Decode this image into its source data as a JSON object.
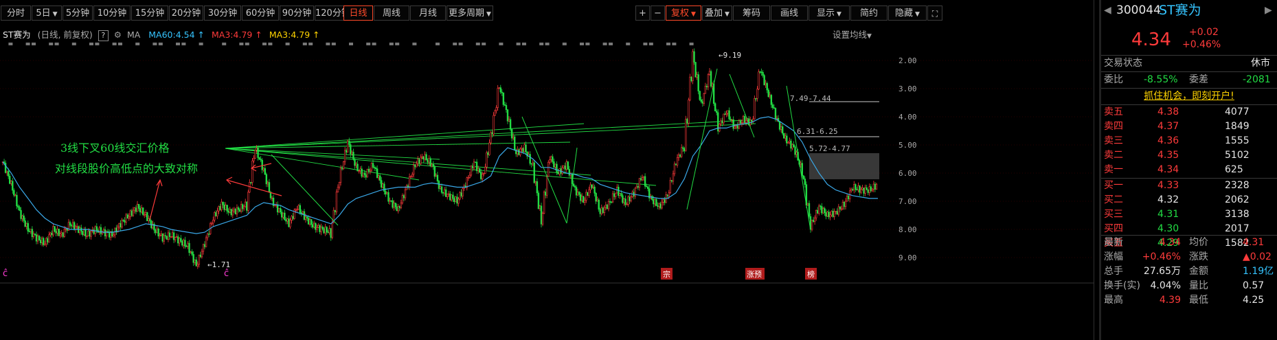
{
  "toolbar": {
    "periods": [
      "分时",
      "5日",
      "5分钟",
      "10分钟",
      "15分钟",
      "20分钟",
      "30分钟",
      "60分钟",
      "90分钟",
      "120分钟",
      "日线",
      "周线",
      "月线",
      "更多周期"
    ],
    "active_period": "日线",
    "plus": "+",
    "minus": "−",
    "fuquan": "复权",
    "diejia": "叠加",
    "chouma": "筹码",
    "huaxian": "画线",
    "xianshi": "显示",
    "jianyue": "简约",
    "yincang": "隐藏"
  },
  "info": {
    "name": "ST赛为",
    "mode": "(日线, 前复权)",
    "help": "?",
    "ma_label": "MA",
    "ma60": "MA60:4.54",
    "ma3a": "MA3:4.79",
    "ma3b": "MA3:4.79",
    "setting": "设置均线",
    "up_arrow": "↑"
  },
  "chart": {
    "y_ticks": [
      "9.00",
      "8.00",
      "7.00",
      "6.00",
      "5.00",
      "4.00",
      "3.00",
      "2.00"
    ],
    "label_high": "←9.19",
    "label_low": "←1.71",
    "band1": "7.49-7.44",
    "band2": "6.31-6.25",
    "band3": "5.72-4.77",
    "annotation1": "3线下叉60线交汇价格",
    "annotation2": "对线段股价高低点的大致对称",
    "badge1": "宗",
    "badge2": "涨预",
    "badge3": "榜",
    "colors": {
      "up": "#ff3b3b",
      "down": "#22dd44",
      "ma60": "#3aa8e8",
      "annotation": "#22dd44",
      "arrow": "#ff3b3b"
    }
  },
  "chart_data": {
    "type": "line",
    "series": [
      {
        "name": "MA60",
        "value_last": 4.54
      },
      {
        "name": "MA3",
        "value_last": 4.79
      }
    ],
    "ylim": [
      1.7,
      9.3
    ],
    "y_ticks": [
      2.0,
      3.0,
      4.0,
      5.0,
      6.0,
      7.0,
      8.0,
      9.0
    ],
    "price_path": [
      5.4,
      4.6,
      3.6,
      3.0,
      2.7,
      2.5,
      3.0,
      2.8,
      3.2,
      3.0,
      2.8,
      3.0,
      2.9,
      2.8,
      3.2,
      3.5,
      3.8,
      3.5,
      3.0,
      2.7,
      2.8,
      2.6,
      2.4,
      1.71,
      2.5,
      3.4,
      3.9,
      3.6,
      3.7,
      3.9,
      5.9,
      5.1,
      4.0,
      3.6,
      3.2,
      3.8,
      3.4,
      3.1,
      3.0,
      2.9,
      4.8,
      6.1,
      5.2,
      4.9,
      5.3,
      4.6,
      4.0,
      3.7,
      4.5,
      5.3,
      5.6,
      5.3,
      4.4,
      4.2,
      4.0,
      4.6,
      5.4,
      4.8,
      6.3,
      8.1,
      7.0,
      5.7,
      5.9,
      5.2,
      3.3,
      5.6,
      5.0,
      5.3,
      4.4,
      4.0,
      4.6,
      3.6,
      3.9,
      4.4,
      3.9,
      4.3,
      4.9,
      4.1,
      3.8,
      4.2,
      5.4,
      6.0,
      9.19,
      7.4,
      8.6,
      6.6,
      7.2,
      6.6,
      6.9,
      6.8,
      8.7,
      7.8,
      6.9,
      6.2,
      5.9,
      5.1,
      3.1,
      3.8,
      3.5,
      3.6,
      3.9,
      4.5,
      4.4,
      4.4,
      4.6
    ],
    "ma60_path": [
      5.4,
      5.0,
      4.5,
      4.1,
      3.7,
      3.4,
      3.2,
      3.1,
      3.0,
      3.0,
      3.0,
      2.95,
      2.9,
      2.9,
      2.95,
      3.0,
      3.1,
      3.2,
      3.15,
      3.1,
      3.0,
      2.95,
      2.9,
      2.85,
      2.9,
      3.1,
      3.2,
      3.3,
      3.4,
      3.5,
      3.8,
      3.95,
      3.9,
      3.85,
      3.7,
      3.6,
      3.5,
      3.4,
      3.3,
      3.2,
      3.5,
      3.9,
      4.1,
      4.2,
      4.3,
      4.4,
      4.45,
      4.5,
      4.5,
      4.5,
      4.6,
      4.65,
      4.6,
      4.55,
      4.5,
      4.5,
      4.6,
      4.7,
      4.9,
      5.6,
      5.9,
      5.8,
      5.7,
      5.5,
      5.2,
      5.2,
      5.1,
      5.0,
      4.95,
      4.85,
      4.8,
      4.6,
      4.5,
      4.4,
      4.3,
      4.25,
      4.2,
      4.15,
      4.1,
      4.1,
      4.3,
      4.8,
      5.6,
      6.0,
      6.5,
      6.6,
      6.6,
      6.7,
      6.75,
      6.8,
      6.95,
      7.0,
      6.9,
      6.7,
      6.5,
      6.1,
      5.5,
      5.0,
      4.6,
      4.4,
      4.3,
      4.2,
      4.15,
      4.1,
      4.1
    ]
  },
  "side": {
    "code": "300044",
    "name": "ST赛为",
    "price": "4.34",
    "change": "+0.02",
    "change_pct": "+0.46%",
    "status_label": "交易状态",
    "status_value": "休市",
    "weibi_label": "委比",
    "weibi_value": "-8.55%",
    "weicha_label": "委差",
    "weicha_value": "-2081",
    "promo": "抓住机会，即刻开户!",
    "asks": [
      {
        "label": "卖五",
        "price": "4.38",
        "vol": "4077"
      },
      {
        "label": "卖四",
        "price": "4.37",
        "vol": "1849"
      },
      {
        "label": "卖三",
        "price": "4.36",
        "vol": "1555"
      },
      {
        "label": "卖二",
        "price": "4.35",
        "vol": "5102"
      },
      {
        "label": "卖一",
        "price": "4.34",
        "vol": "625"
      }
    ],
    "bids": [
      {
        "label": "买一",
        "price": "4.33",
        "vol": "2328"
      },
      {
        "label": "买二",
        "price": "4.32",
        "vol": "2062"
      },
      {
        "label": "买三",
        "price": "4.31",
        "vol": "3138"
      },
      {
        "label": "买四",
        "price": "4.30",
        "vol": "2017"
      },
      {
        "label": "买五",
        "price": "4.29",
        "vol": "1582"
      }
    ],
    "stats": [
      {
        "l1": "最新",
        "v1": "4.34",
        "l2": "均价",
        "v2": "4.31"
      },
      {
        "l1": "涨幅",
        "v1": "+0.46%",
        "l2": "涨跌",
        "v2": "▲0.02"
      },
      {
        "l1": "总手",
        "v1": "27.65万",
        "l2": "金额",
        "v2": "1.19亿"
      },
      {
        "l1": "换手(实)",
        "v1": "4.04%",
        "l2": "量比",
        "v2": "0.57"
      },
      {
        "l1": "最高",
        "v1": "4.39",
        "l2": "最低",
        "v2": "4.25"
      }
    ]
  }
}
